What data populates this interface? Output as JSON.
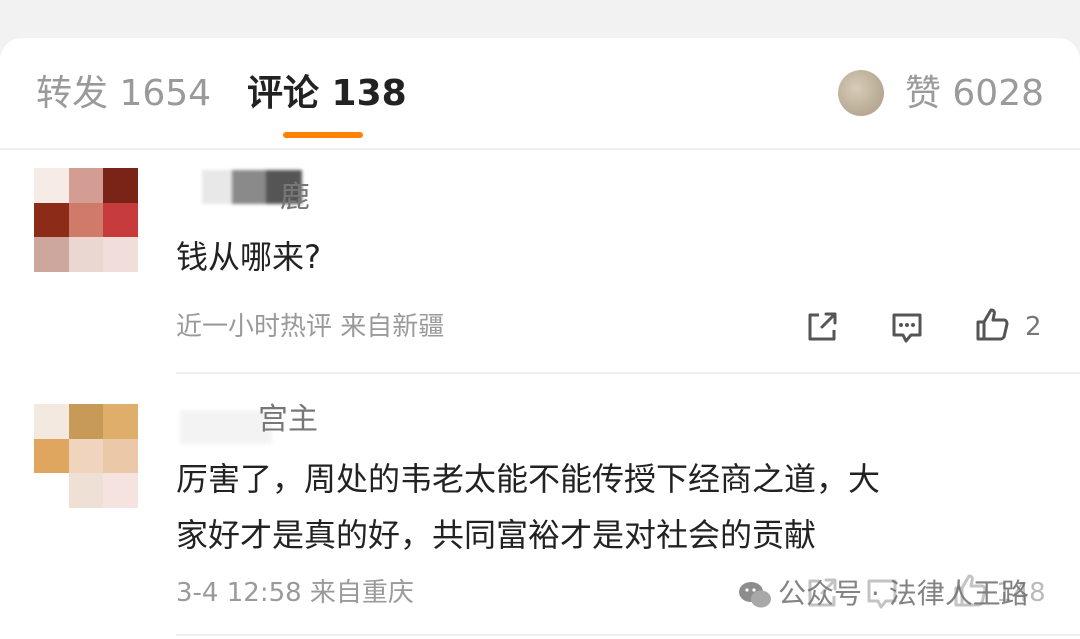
{
  "tabs": {
    "repost": "转发 1654",
    "comments": "评论 138",
    "likes": "赞 6028"
  },
  "comments": [
    {
      "name_visible": "鹿",
      "text": "钱从哪来?",
      "meta": "近一小时热评  来自新疆",
      "like_count": "2"
    },
    {
      "name_visible": "宫主",
      "text_line1": "厉害了，周处的韦老太能不能传授下经商之道，大",
      "text_line2": "家好才是真的好，共同富裕才是对社会的贡献",
      "meta": "3-4 12:58  来自重庆",
      "like_count": "148"
    }
  ],
  "watermark": "公众号 · 法律人王路",
  "icons": [
    "share-icon",
    "comment-icon",
    "thumbs-up-icon",
    "wechat-icon"
  ],
  "colors": {
    "accent": "#ff8200",
    "text": "#222222",
    "muted": "#9a9a9a"
  }
}
